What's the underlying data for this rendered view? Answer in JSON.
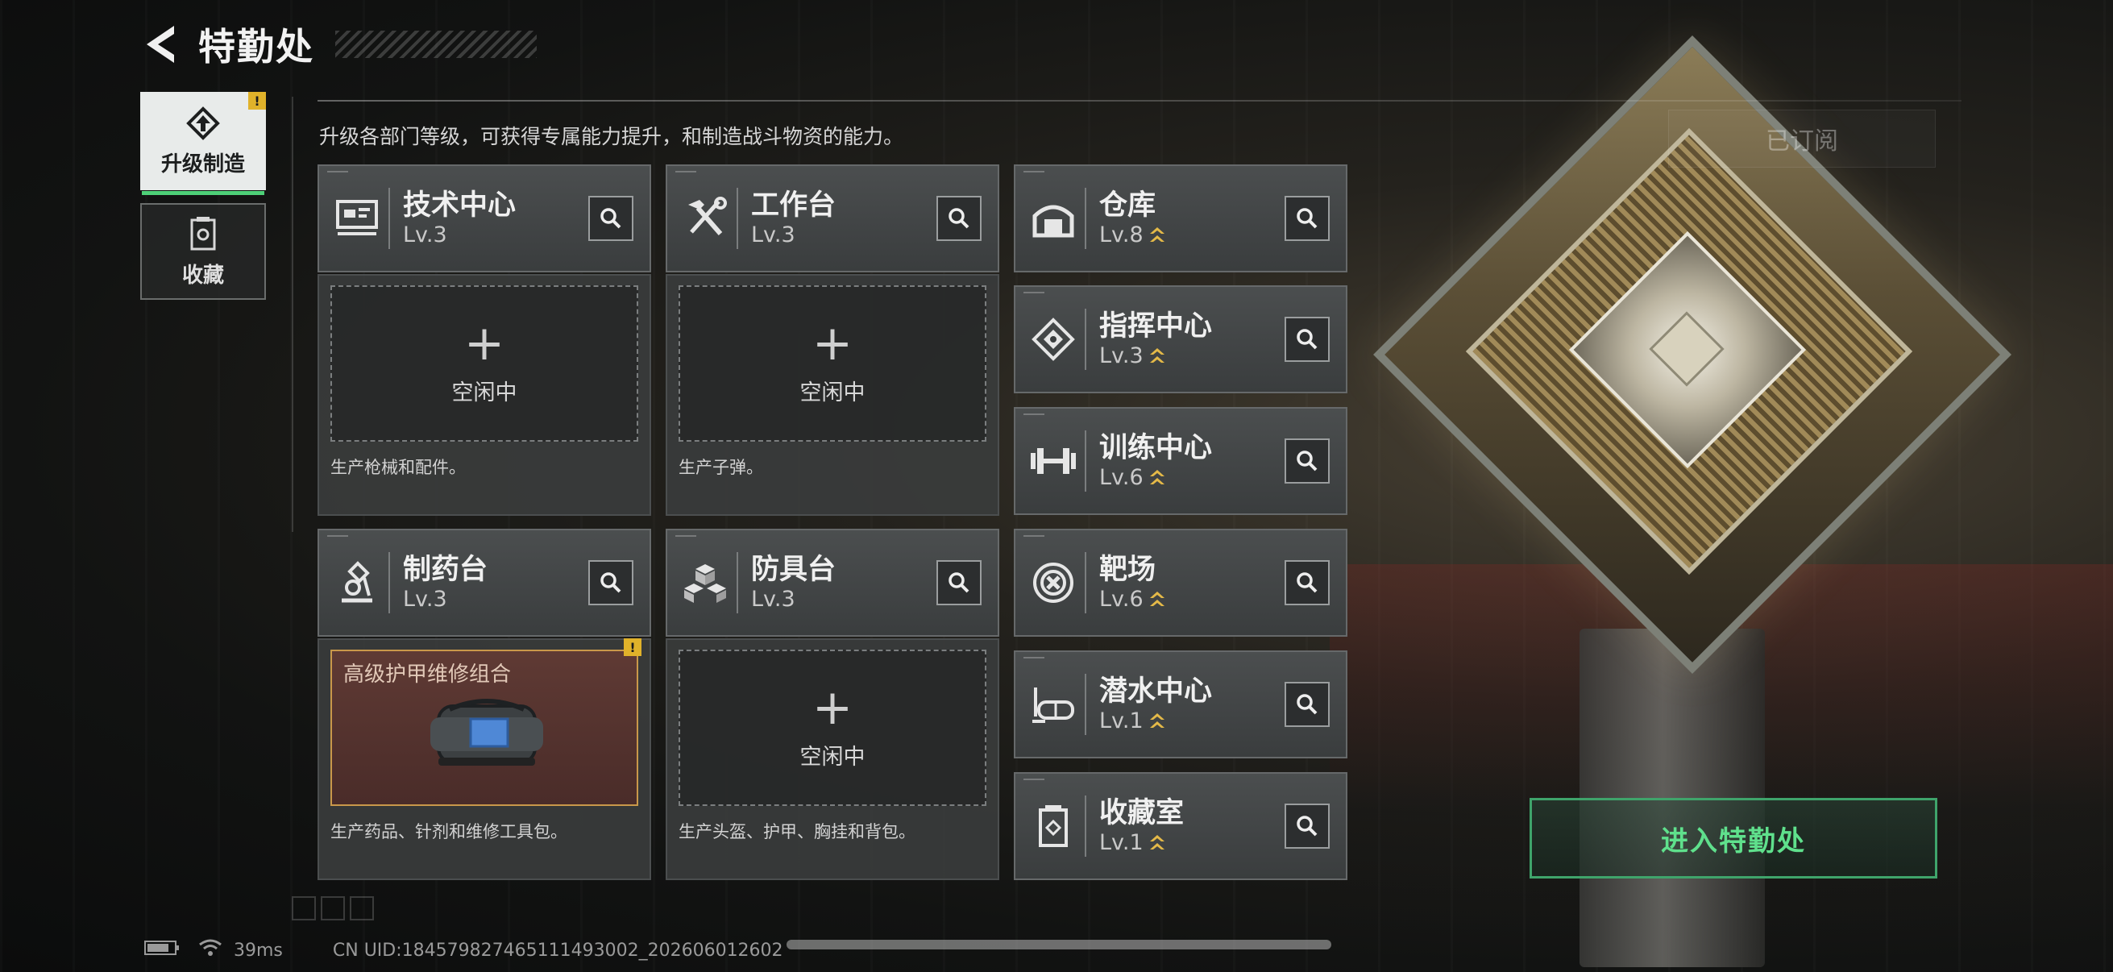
{
  "header": {
    "title": "特勤处"
  },
  "nav": {
    "tabs": [
      {
        "label": "升级制造",
        "icon": "upgrade-icon",
        "active": true,
        "alert": "!"
      },
      {
        "label": "收藏",
        "icon": "collection-icon",
        "active": false
      }
    ]
  },
  "description": "升级各部门等级，可获得专属能力提升，和制造战斗物资的能力。",
  "subscribe_label": "已订阅",
  "production": [
    {
      "name": "技术中心",
      "level": "Lv.3",
      "icon": "monitor-icon",
      "slot_state": "空闲中",
      "slot_desc": "生产枪械和配件。"
    },
    {
      "name": "工作台",
      "level": "Lv.3",
      "icon": "tools-icon",
      "slot_state": "空闲中",
      "slot_desc": "生产子弹。"
    },
    {
      "name": "制药台",
      "level": "Lv.3",
      "icon": "microscope-icon",
      "slot_item": "高级护甲维修组合",
      "slot_alert": "!",
      "slot_desc": "生产药品、针剂和维修工具包。"
    },
    {
      "name": "防具台",
      "level": "Lv.3",
      "icon": "armor-blocks-icon",
      "slot_state": "空闲中",
      "slot_desc": "生产头盔、护甲、胸挂和背包。"
    }
  ],
  "facilities": [
    {
      "name": "仓库",
      "level": "Lv.8",
      "icon": "warehouse-icon",
      "upgrade": true
    },
    {
      "name": "指挥中心",
      "level": "Lv.3",
      "icon": "command-icon",
      "upgrade": true
    },
    {
      "name": "训练中心",
      "level": "Lv.6",
      "icon": "dumbbell-icon",
      "upgrade": true
    },
    {
      "name": "靶场",
      "level": "Lv.6",
      "icon": "target-icon",
      "upgrade": true
    },
    {
      "name": "潜水中心",
      "level": "Lv.1",
      "icon": "diving-mask-icon",
      "upgrade": true
    },
    {
      "name": "收藏室",
      "level": "Lv.1",
      "icon": "collection-room-icon",
      "upgrade": true
    }
  ],
  "enter_button": "进入特勤处",
  "status_bar": {
    "ping": "39ms",
    "uid": "CN UID:18457982746511149​3002_20260601​2602"
  },
  "colors": {
    "accent_green": "#4ed078",
    "alert_yellow": "#e0b22a",
    "upgrade_gold": "#e4b948"
  }
}
